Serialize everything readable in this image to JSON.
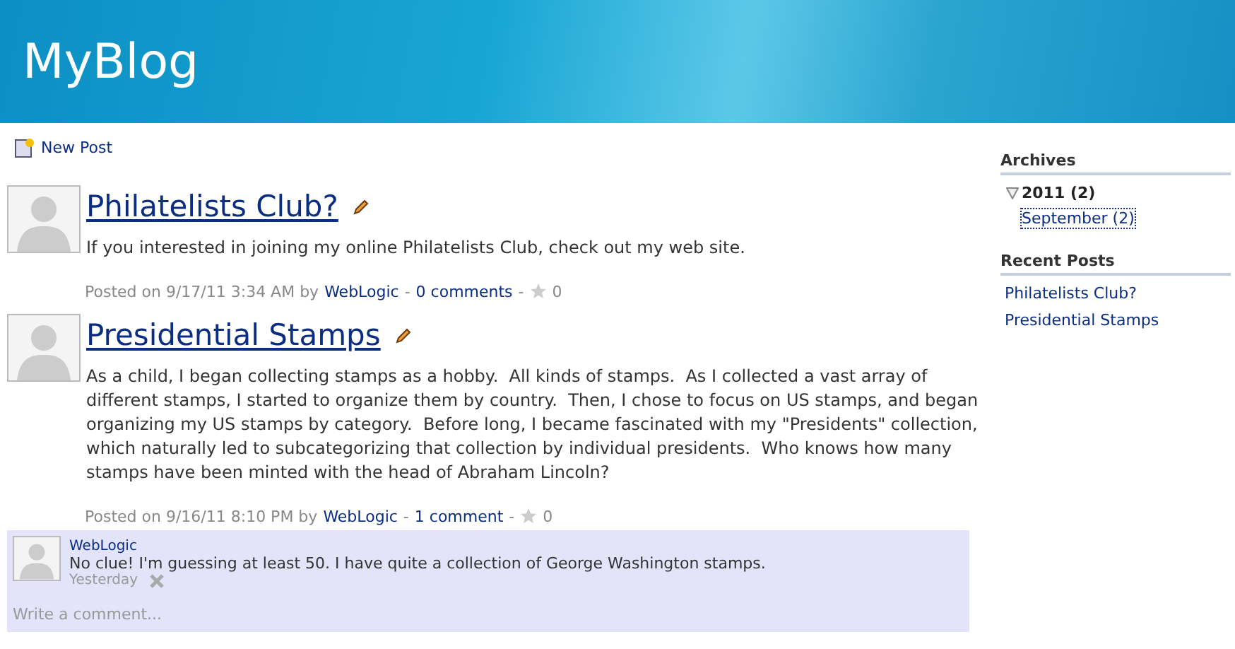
{
  "header": {
    "title": "MyBlog"
  },
  "toolbar": {
    "new_post": "New Post"
  },
  "posts": [
    {
      "title": "Philatelists Club?",
      "body": "If you interested in joining my online Philatelists Club, check out my web site.",
      "posted": "Posted on 9/17/11 3:34 AM by",
      "author": "WebLogic",
      "separator_1": "-",
      "comments": "0 comments",
      "separator_2": "-",
      "rating": "0"
    },
    {
      "title": "Presidential Stamps",
      "body": "As a child, I began collecting stamps as a hobby.  All kinds of stamps.  As I collected a vast array of different stamps, I started to organize them by country.  Then, I chose to focus on US stamps, and began organizing my US stamps by category.  Before long, I became fascinated with my \"Presidents\" collection, which naturally led to subcategorizing that collection by individual presidents.  Who knows how many stamps have been minted with the head of Abraham Lincoln?",
      "posted": "Posted on 9/16/11 8:10 PM by",
      "author": "WebLogic",
      "separator_1": "-",
      "comments": "1 comment",
      "separator_2": "-",
      "rating": "0",
      "comment_list": [
        {
          "author": "WebLogic",
          "text": "No clue! I'm guessing at least 50. I have quite a collection of George Washington stamps.",
          "time": "Yesterday"
        }
      ],
      "comment_field": {
        "placeholder": "Write a comment..."
      }
    }
  ],
  "sidebar": {
    "archives": {
      "heading": "Archives",
      "years": [
        {
          "label": "2011 (2)",
          "expanded": true,
          "children": [
            {
              "label": "September (2)",
              "selected": true
            }
          ]
        }
      ]
    },
    "recent_posts": {
      "heading": "Recent Posts",
      "items": [
        "Philatelists Club?",
        "Presidential Stamps"
      ]
    }
  }
}
